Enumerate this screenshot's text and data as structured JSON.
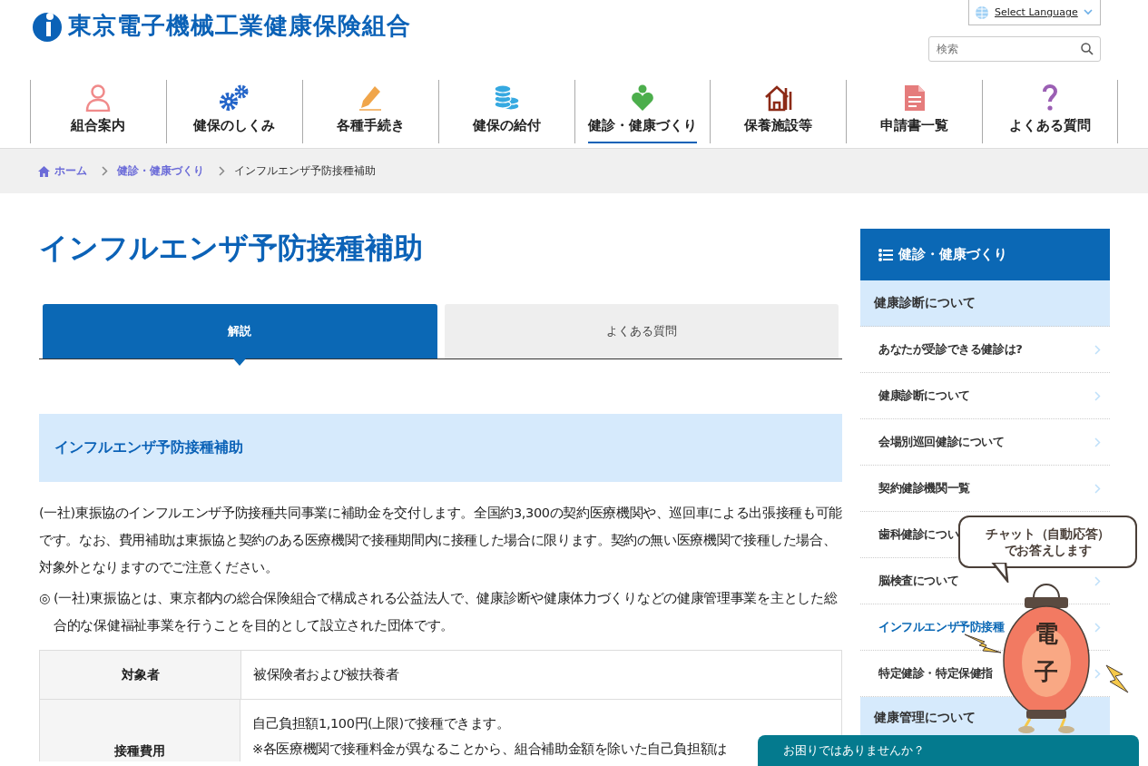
{
  "header": {
    "site_title": "東京電子機械工業健康保険組合",
    "language_select": {
      "label": "Select Language"
    },
    "search": {
      "placeholder": "検索"
    }
  },
  "nav": [
    {
      "label": "組合案内",
      "selected": false
    },
    {
      "label": "健保のしくみ",
      "selected": false
    },
    {
      "label": "各種手続き",
      "selected": false
    },
    {
      "label": "健保の給付",
      "selected": false
    },
    {
      "label": "健診・健康づくり",
      "selected": true
    },
    {
      "label": "保養施設等",
      "selected": false
    },
    {
      "label": "申請書一覧",
      "selected": false
    },
    {
      "label": "よくある質問",
      "selected": false
    }
  ],
  "breadcrumb": [
    {
      "label": "ホーム",
      "kind": "home"
    },
    {
      "label": "健診・健康づくり",
      "kind": "link"
    },
    {
      "label": "インフルエンザ予防接種補助",
      "kind": "current"
    }
  ],
  "page_title": "インフルエンザ予防接種補助",
  "tabs": [
    {
      "label": "解説",
      "selected": true
    },
    {
      "label": "よくある質問",
      "selected": false
    }
  ],
  "section_heading": "インフルエンザ予防接種補助",
  "paragraphs": [
    "(一社)東振協のインフルエンザ予防接種共同事業に補助金を交付します。全国約3,300の契約医療機関や、巡回車による出張接種も可能です。なお、費用補助は東振協と契約のある医療機関で接種期間内に接種した場合に限ります。契約の無い医療機関で接種した場合、対象外となりますのでご注意ください。"
  ],
  "note": {
    "mark": "◎",
    "text": "(一社)東振協とは、東京都内の総合保険組合で構成される公益法人で、健康診断や健康体力づくりなどの健康管理事業を主とした総合的な保健福祉事業を行うことを目的として設立された団体です。"
  },
  "table": {
    "rows": [
      {
        "header": "対象者",
        "lines": [
          "被保険者および被扶養者"
        ]
      },
      {
        "header": "接種費用",
        "lines": [
          "自己負担額1,100円(上限)で接種できます。",
          "※各医療機関で接種料金が異なることから、組合補助金額を除いた自己負担額は"
        ]
      }
    ]
  },
  "sidebar": {
    "title": "健診・健康づくり",
    "groups": [
      {
        "label": "健康診断について",
        "items": [
          {
            "label": "あなたが受診できる健診は?",
            "selected": false
          },
          {
            "label": "健康診断について",
            "selected": false
          },
          {
            "label": "会場別巡回健診について",
            "selected": false
          },
          {
            "label": "契約健診機関一覧",
            "selected": false
          },
          {
            "label": "歯科健診につい",
            "selected": false
          },
          {
            "label": "脳検査について",
            "selected": false
          },
          {
            "label": "インフルエンザ予防接種",
            "selected": true
          },
          {
            "label": "特定健診・特定保健指",
            "selected": false
          }
        ]
      },
      {
        "label": "健康管理について"
      }
    ]
  },
  "chat": {
    "bubble_lines": [
      "チャット（自動応答）",
      "でお答えします"
    ],
    "lantern_text": "電子",
    "bar": "お困りではありませんか？"
  }
}
